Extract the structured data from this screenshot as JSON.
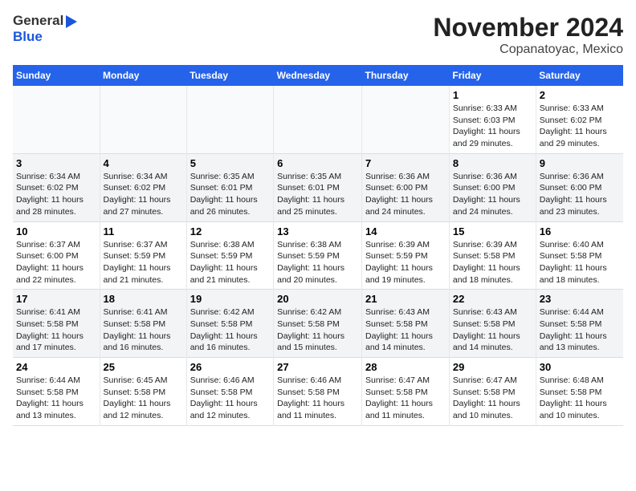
{
  "logo": {
    "line1": "General",
    "line2": "Blue"
  },
  "title": "November 2024",
  "subtitle": "Copanatoyac, Mexico",
  "days_of_week": [
    "Sunday",
    "Monday",
    "Tuesday",
    "Wednesday",
    "Thursday",
    "Friday",
    "Saturday"
  ],
  "weeks": [
    [
      {
        "day": "",
        "info": ""
      },
      {
        "day": "",
        "info": ""
      },
      {
        "day": "",
        "info": ""
      },
      {
        "day": "",
        "info": ""
      },
      {
        "day": "",
        "info": ""
      },
      {
        "day": "1",
        "info": "Sunrise: 6:33 AM\nSunset: 6:03 PM\nDaylight: 11 hours and 29 minutes."
      },
      {
        "day": "2",
        "info": "Sunrise: 6:33 AM\nSunset: 6:02 PM\nDaylight: 11 hours and 29 minutes."
      }
    ],
    [
      {
        "day": "3",
        "info": "Sunrise: 6:34 AM\nSunset: 6:02 PM\nDaylight: 11 hours and 28 minutes."
      },
      {
        "day": "4",
        "info": "Sunrise: 6:34 AM\nSunset: 6:02 PM\nDaylight: 11 hours and 27 minutes."
      },
      {
        "day": "5",
        "info": "Sunrise: 6:35 AM\nSunset: 6:01 PM\nDaylight: 11 hours and 26 minutes."
      },
      {
        "day": "6",
        "info": "Sunrise: 6:35 AM\nSunset: 6:01 PM\nDaylight: 11 hours and 25 minutes."
      },
      {
        "day": "7",
        "info": "Sunrise: 6:36 AM\nSunset: 6:00 PM\nDaylight: 11 hours and 24 minutes."
      },
      {
        "day": "8",
        "info": "Sunrise: 6:36 AM\nSunset: 6:00 PM\nDaylight: 11 hours and 24 minutes."
      },
      {
        "day": "9",
        "info": "Sunrise: 6:36 AM\nSunset: 6:00 PM\nDaylight: 11 hours and 23 minutes."
      }
    ],
    [
      {
        "day": "10",
        "info": "Sunrise: 6:37 AM\nSunset: 6:00 PM\nDaylight: 11 hours and 22 minutes."
      },
      {
        "day": "11",
        "info": "Sunrise: 6:37 AM\nSunset: 5:59 PM\nDaylight: 11 hours and 21 minutes."
      },
      {
        "day": "12",
        "info": "Sunrise: 6:38 AM\nSunset: 5:59 PM\nDaylight: 11 hours and 21 minutes."
      },
      {
        "day": "13",
        "info": "Sunrise: 6:38 AM\nSunset: 5:59 PM\nDaylight: 11 hours and 20 minutes."
      },
      {
        "day": "14",
        "info": "Sunrise: 6:39 AM\nSunset: 5:59 PM\nDaylight: 11 hours and 19 minutes."
      },
      {
        "day": "15",
        "info": "Sunrise: 6:39 AM\nSunset: 5:58 PM\nDaylight: 11 hours and 18 minutes."
      },
      {
        "day": "16",
        "info": "Sunrise: 6:40 AM\nSunset: 5:58 PM\nDaylight: 11 hours and 18 minutes."
      }
    ],
    [
      {
        "day": "17",
        "info": "Sunrise: 6:41 AM\nSunset: 5:58 PM\nDaylight: 11 hours and 17 minutes."
      },
      {
        "day": "18",
        "info": "Sunrise: 6:41 AM\nSunset: 5:58 PM\nDaylight: 11 hours and 16 minutes."
      },
      {
        "day": "19",
        "info": "Sunrise: 6:42 AM\nSunset: 5:58 PM\nDaylight: 11 hours and 16 minutes."
      },
      {
        "day": "20",
        "info": "Sunrise: 6:42 AM\nSunset: 5:58 PM\nDaylight: 11 hours and 15 minutes."
      },
      {
        "day": "21",
        "info": "Sunrise: 6:43 AM\nSunset: 5:58 PM\nDaylight: 11 hours and 14 minutes."
      },
      {
        "day": "22",
        "info": "Sunrise: 6:43 AM\nSunset: 5:58 PM\nDaylight: 11 hours and 14 minutes."
      },
      {
        "day": "23",
        "info": "Sunrise: 6:44 AM\nSunset: 5:58 PM\nDaylight: 11 hours and 13 minutes."
      }
    ],
    [
      {
        "day": "24",
        "info": "Sunrise: 6:44 AM\nSunset: 5:58 PM\nDaylight: 11 hours and 13 minutes."
      },
      {
        "day": "25",
        "info": "Sunrise: 6:45 AM\nSunset: 5:58 PM\nDaylight: 11 hours and 12 minutes."
      },
      {
        "day": "26",
        "info": "Sunrise: 6:46 AM\nSunset: 5:58 PM\nDaylight: 11 hours and 12 minutes."
      },
      {
        "day": "27",
        "info": "Sunrise: 6:46 AM\nSunset: 5:58 PM\nDaylight: 11 hours and 11 minutes."
      },
      {
        "day": "28",
        "info": "Sunrise: 6:47 AM\nSunset: 5:58 PM\nDaylight: 11 hours and 11 minutes."
      },
      {
        "day": "29",
        "info": "Sunrise: 6:47 AM\nSunset: 5:58 PM\nDaylight: 11 hours and 10 minutes."
      },
      {
        "day": "30",
        "info": "Sunrise: 6:48 AM\nSunset: 5:58 PM\nDaylight: 11 hours and 10 minutes."
      }
    ]
  ]
}
